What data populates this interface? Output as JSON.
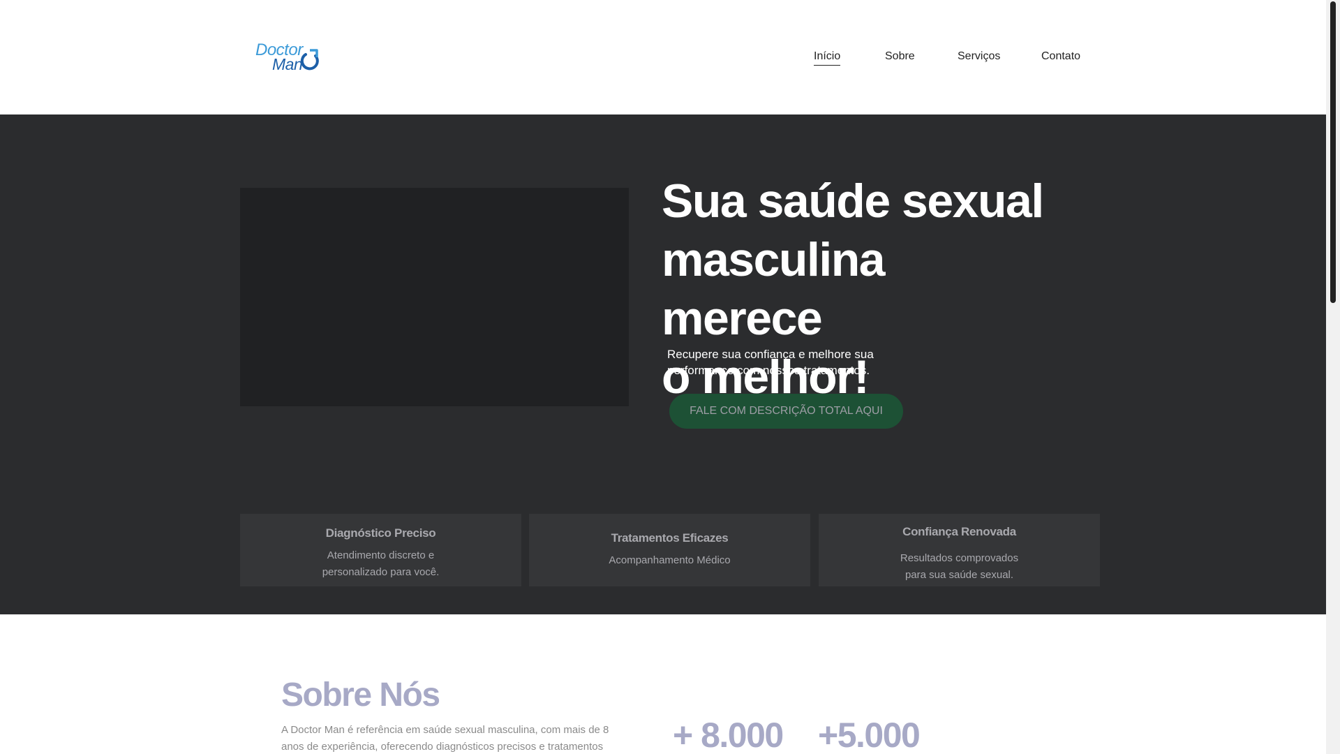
{
  "header": {
    "logo": {
      "line1": "Doctor",
      "line2": "Man",
      "icon": "male-symbol-icon"
    },
    "nav": [
      {
        "label": "Início",
        "active": true
      },
      {
        "label": "Sobre",
        "active": false
      },
      {
        "label": "Serviços",
        "active": false
      },
      {
        "label": "Contato",
        "active": false
      }
    ]
  },
  "hero": {
    "title_line1": "Sua saúde sexual",
    "title_line2": "masculina merece",
    "title_line3": "o melhor!",
    "subtitle_line1": "Recupere sua confiança e melhore sua",
    "subtitle_line2": "performance com nossos tratamentos.",
    "cta_label": "FALE COM DESCRIÇÃO TOTAL AQUI"
  },
  "cards": [
    {
      "title": "Diagnóstico Preciso",
      "line1": "Atendimento discreto e",
      "line2": "personalizado para você."
    },
    {
      "title": "Tratamentos Eficazes",
      "line1": "Acompanhamento Médico",
      "line2": ""
    },
    {
      "title": "Confiança Renovada",
      "line1": "Resultados comprovados",
      "line2": "para sua saúde sexual."
    }
  ],
  "about": {
    "title": "Sobre Nós",
    "text_line1": "A Doctor Man é referência em saúde sexual masculina, com mais de 8",
    "text_line2": "anos de experiência, oferecendo diagnósticos precisos e tratamentos",
    "stat1": "+ 8.000",
    "stat2": "+5.000"
  },
  "colors": {
    "hero_bg": "#2b2c2e",
    "cta_bg": "#1d5135",
    "logo_light": "#3b9ad8",
    "logo_dark": "#1c5fa8",
    "accent_text": "#a7a9c6"
  }
}
